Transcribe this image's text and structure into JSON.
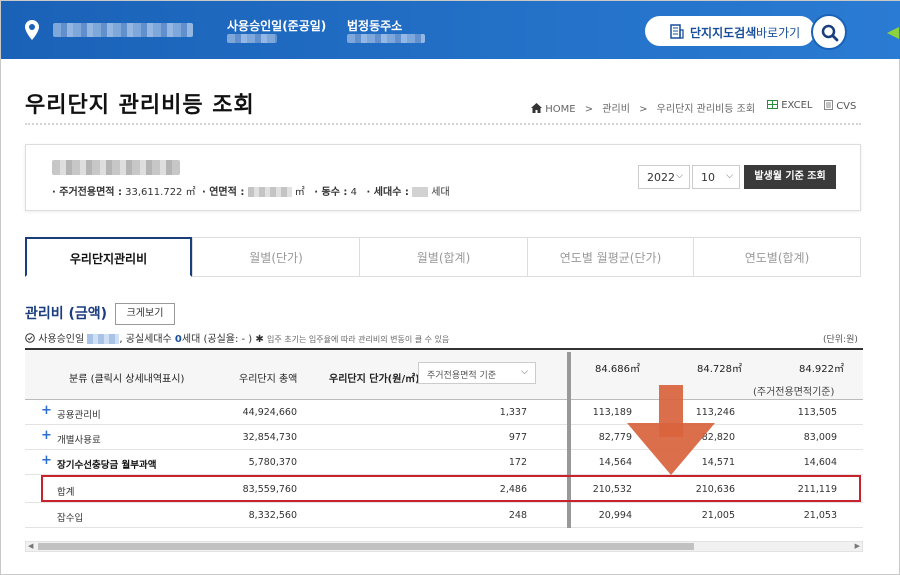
{
  "header": {
    "label_approval": "사용승인일(준공일)",
    "label_address": "법정동주소",
    "map_button_strong": "단지지도검색",
    "map_button_light": "바로가기"
  },
  "title": "우리단지 관리비등 조회",
  "breadcrumb": [
    "HOME",
    "관리비",
    "우리단지 관리비등 조회"
  ],
  "breadcrumb_sep": ">",
  "export": {
    "excel": "EXCEL",
    "csv": "CVS"
  },
  "info": {
    "area_label": "· 주거전용면적 :",
    "area_value": "33,611.722 ㎡",
    "total_area_label": "· 연면적 :",
    "total_area_unit": "㎡",
    "dong_label": "· 동수 :",
    "dong_value": "4",
    "household_label": "· 세대수 :",
    "household_unit": "세대"
  },
  "controls": {
    "year": "2022",
    "month": "10",
    "query_button": "발생월 기준 조회"
  },
  "tabs": [
    "우리단지관리비",
    "월별(단가)",
    "월별(합계)",
    "연도별 월평균(단가)",
    "연도별(합계)"
  ],
  "section": {
    "title": "관리비 (금액)",
    "enlarge_button": "크게보기",
    "approval_label": "사용승인일",
    "vacancy_text": ", 공실세대수",
    "vacancy_count": "0",
    "vacancy_unit": "세대 (공실율: - )",
    "footnote": "입주 초기는 입주율에 따라 관리비의 변동이 클 수 있음",
    "unit": "(단위:원)"
  },
  "table": {
    "headers": {
      "category": "분류 (클릭시 상세내역표시)",
      "total": "우리단지 총액",
      "unit_price": "우리단지 단가(원/㎡)",
      "unit_select": "주거전용면적 기준",
      "areas": [
        "84.686㎡",
        "84.728㎡",
        "84.922㎡"
      ],
      "area_note": "(주거전용면적기준)"
    },
    "rows": [
      {
        "label": "공용관리비",
        "expand": true,
        "bold": false,
        "total": "44,924,660",
        "unit": "1,337",
        "a1": "113,189",
        "a2": "113,246",
        "a3": "113,505"
      },
      {
        "label": "개별사용료",
        "expand": true,
        "bold": false,
        "total": "32,854,730",
        "unit": "977",
        "a1": "82,779",
        "a2": "82,820",
        "a3": "83,009"
      },
      {
        "label": "장기수선충당금 월부과액",
        "expand": true,
        "bold": true,
        "total": "5,780,370",
        "unit": "172",
        "a1": "14,564",
        "a2": "14,571",
        "a3": "14,604"
      },
      {
        "label": "합계",
        "expand": false,
        "bold": false,
        "total": "83,559,760",
        "unit": "2,486",
        "a1": "210,532",
        "a2": "210,636",
        "a3": "211,119"
      },
      {
        "label": "잡수입",
        "expand": false,
        "bold": false,
        "total": "8,332,560",
        "unit": "248",
        "a1": "20,994",
        "a2": "21,005",
        "a3": "21,053"
      }
    ]
  },
  "colors": {
    "header_blue": "#1a62b8",
    "highlight_red": "#c8232c",
    "arrow": "#d9633c"
  }
}
